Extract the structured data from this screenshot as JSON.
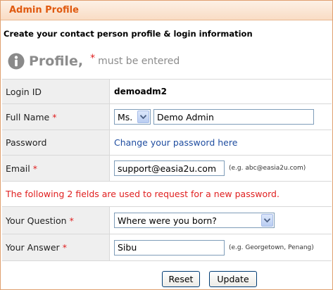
{
  "panel": {
    "title": "Admin Profile"
  },
  "intro": "Create your contact person profile & login information",
  "profile_heading": {
    "icon": "info-icon",
    "word": "Profile,",
    "required_star": "*",
    "required_text": "must  be  entered"
  },
  "form": {
    "login_id": {
      "label": "Login ID",
      "value": "demoadm2"
    },
    "full_name": {
      "label": "Full Name",
      "star": "*",
      "title_value": "Ms.",
      "name_value": "Demo Admin"
    },
    "password": {
      "label": "Password",
      "link": "Change your password here"
    },
    "email": {
      "label": "Email",
      "star": "*",
      "value": "support@easia2u.com",
      "hint": "(e.g. abc@easia2u.com)"
    },
    "note": "The following 2 fields are used to request for a new password.",
    "question": {
      "label": "Your Question",
      "star": "*",
      "value": "Where were you born?"
    },
    "answer": {
      "label": "Your Answer",
      "star": "*",
      "value": "Sibu",
      "hint": "(e.g. Georgetown, Penang)"
    }
  },
  "buttons": {
    "reset": "Reset",
    "update": "Update"
  },
  "colors": {
    "title": "#e05a10",
    "required": "#e02020",
    "link": "#1f4da0",
    "border": "#e0a070"
  }
}
